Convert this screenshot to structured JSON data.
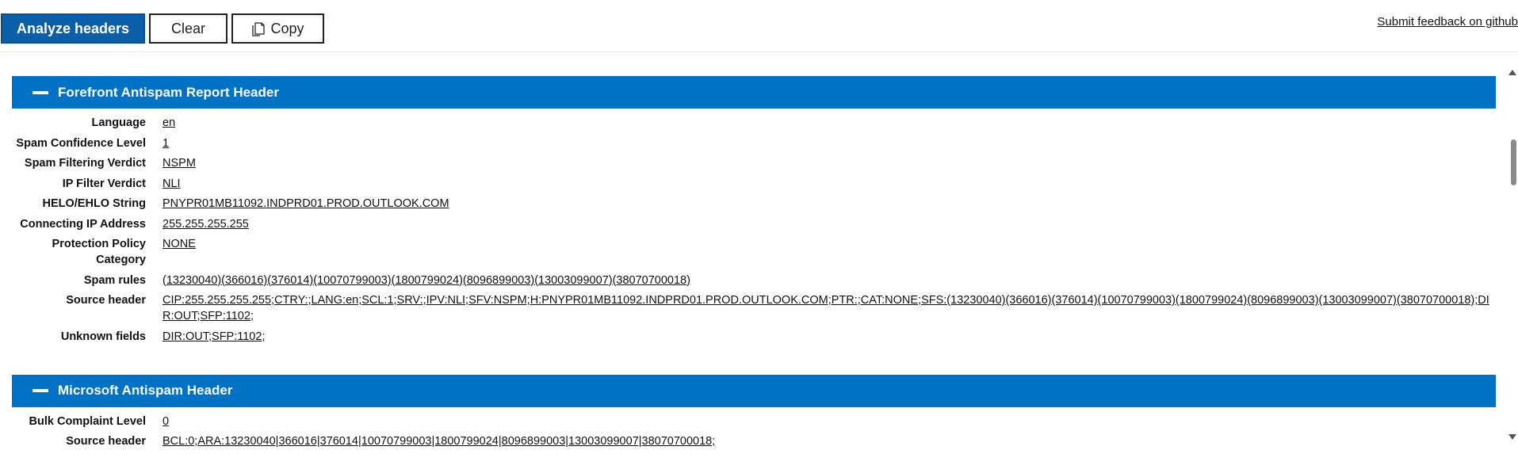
{
  "toolbar": {
    "analyze_label": "Analyze headers",
    "clear_label": "Clear",
    "copy_label": "Copy",
    "feedback_link": "Submit feedback on github"
  },
  "sections": [
    {
      "title": "Forefront Antispam Report Header",
      "rows": [
        {
          "label": "Language",
          "value": "en"
        },
        {
          "label": "Spam Confidence Level",
          "value": "1"
        },
        {
          "label": "Spam Filtering Verdict",
          "value": "NSPM"
        },
        {
          "label": "IP Filter Verdict",
          "value": "NLI"
        },
        {
          "label": "HELO/EHLO String",
          "value": "PNYPR01MB11092.INDPRD01.PROD.OUTLOOK.COM"
        },
        {
          "label": "Connecting IP Address",
          "value": "255.255.255.255"
        },
        {
          "label": "Protection Policy Category",
          "value": "NONE"
        },
        {
          "label": "Spam rules",
          "value": "(13230040)(366016)(376014)(10070799003)(1800799024)(8096899003)(13003099007)(38070700018)"
        },
        {
          "label": "Source header",
          "value": "CIP:255.255.255.255;CTRY:;LANG:en;SCL:1;SRV:;IPV:NLI;SFV:NSPM;H:PNYPR01MB11092.INDPRD01.PROD.OUTLOOK.COM;PTR:;CAT:NONE;SFS:(13230040)(366016)(376014)(10070799003)(1800799024)(8096899003)(13003099007)(38070700018);DIR:OUT;SFP:1102;"
        },
        {
          "label": "Unknown fields",
          "value": "DIR:OUT;SFP:1102;"
        }
      ]
    },
    {
      "title": "Microsoft Antispam Header",
      "rows": [
        {
          "label": "Bulk Complaint Level",
          "value": "0"
        },
        {
          "label": "Source header",
          "value": "BCL:0;ARA:13230040|366016|376014|10070799003|1800799024|8096899003|13003099007|38070700018;"
        }
      ]
    }
  ],
  "icons": {
    "copy": "copy-icon",
    "collapse": "minus-icon"
  },
  "colors": {
    "primary_button": "#0b5ea8",
    "section_header": "#0072c6"
  }
}
